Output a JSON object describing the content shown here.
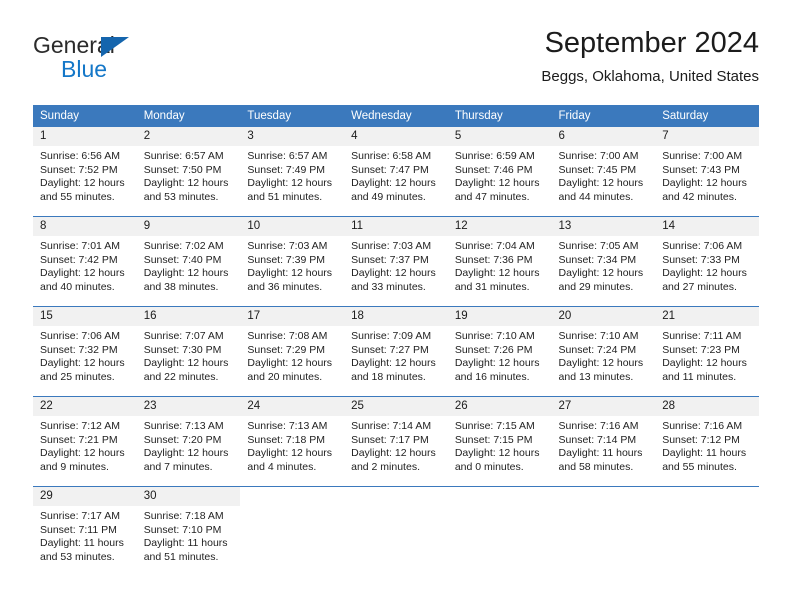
{
  "brand": {
    "name_top": "General",
    "name_bottom": "Blue",
    "accent_color": "#1477c8",
    "triangle_color": "#1565ad"
  },
  "header": {
    "title": "September 2024",
    "subtitle": "Beggs, Oklahoma, United States"
  },
  "theme": {
    "header_blue": "#3b79bd",
    "daynum_band": "#f1f1f1",
    "text": "#1c1c1c"
  },
  "weekday_headers": [
    "Sunday",
    "Monday",
    "Tuesday",
    "Wednesday",
    "Thursday",
    "Friday",
    "Saturday"
  ],
  "weeks": [
    [
      {
        "day": "1",
        "sunrise": "Sunrise: 6:56 AM",
        "sunset": "Sunset: 7:52 PM",
        "daylight_line1": "Daylight: 12 hours",
        "daylight_line2": "and 55 minutes."
      },
      {
        "day": "2",
        "sunrise": "Sunrise: 6:57 AM",
        "sunset": "Sunset: 7:50 PM",
        "daylight_line1": "Daylight: 12 hours",
        "daylight_line2": "and 53 minutes."
      },
      {
        "day": "3",
        "sunrise": "Sunrise: 6:57 AM",
        "sunset": "Sunset: 7:49 PM",
        "daylight_line1": "Daylight: 12 hours",
        "daylight_line2": "and 51 minutes."
      },
      {
        "day": "4",
        "sunrise": "Sunrise: 6:58 AM",
        "sunset": "Sunset: 7:47 PM",
        "daylight_line1": "Daylight: 12 hours",
        "daylight_line2": "and 49 minutes."
      },
      {
        "day": "5",
        "sunrise": "Sunrise: 6:59 AM",
        "sunset": "Sunset: 7:46 PM",
        "daylight_line1": "Daylight: 12 hours",
        "daylight_line2": "and 47 minutes."
      },
      {
        "day": "6",
        "sunrise": "Sunrise: 7:00 AM",
        "sunset": "Sunset: 7:45 PM",
        "daylight_line1": "Daylight: 12 hours",
        "daylight_line2": "and 44 minutes."
      },
      {
        "day": "7",
        "sunrise": "Sunrise: 7:00 AM",
        "sunset": "Sunset: 7:43 PM",
        "daylight_line1": "Daylight: 12 hours",
        "daylight_line2": "and 42 minutes."
      }
    ],
    [
      {
        "day": "8",
        "sunrise": "Sunrise: 7:01 AM",
        "sunset": "Sunset: 7:42 PM",
        "daylight_line1": "Daylight: 12 hours",
        "daylight_line2": "and 40 minutes."
      },
      {
        "day": "9",
        "sunrise": "Sunrise: 7:02 AM",
        "sunset": "Sunset: 7:40 PM",
        "daylight_line1": "Daylight: 12 hours",
        "daylight_line2": "and 38 minutes."
      },
      {
        "day": "10",
        "sunrise": "Sunrise: 7:03 AM",
        "sunset": "Sunset: 7:39 PM",
        "daylight_line1": "Daylight: 12 hours",
        "daylight_line2": "and 36 minutes."
      },
      {
        "day": "11",
        "sunrise": "Sunrise: 7:03 AM",
        "sunset": "Sunset: 7:37 PM",
        "daylight_line1": "Daylight: 12 hours",
        "daylight_line2": "and 33 minutes."
      },
      {
        "day": "12",
        "sunrise": "Sunrise: 7:04 AM",
        "sunset": "Sunset: 7:36 PM",
        "daylight_line1": "Daylight: 12 hours",
        "daylight_line2": "and 31 minutes."
      },
      {
        "day": "13",
        "sunrise": "Sunrise: 7:05 AM",
        "sunset": "Sunset: 7:34 PM",
        "daylight_line1": "Daylight: 12 hours",
        "daylight_line2": "and 29 minutes."
      },
      {
        "day": "14",
        "sunrise": "Sunrise: 7:06 AM",
        "sunset": "Sunset: 7:33 PM",
        "daylight_line1": "Daylight: 12 hours",
        "daylight_line2": "and 27 minutes."
      }
    ],
    [
      {
        "day": "15",
        "sunrise": "Sunrise: 7:06 AM",
        "sunset": "Sunset: 7:32 PM",
        "daylight_line1": "Daylight: 12 hours",
        "daylight_line2": "and 25 minutes."
      },
      {
        "day": "16",
        "sunrise": "Sunrise: 7:07 AM",
        "sunset": "Sunset: 7:30 PM",
        "daylight_line1": "Daylight: 12 hours",
        "daylight_line2": "and 22 minutes."
      },
      {
        "day": "17",
        "sunrise": "Sunrise: 7:08 AM",
        "sunset": "Sunset: 7:29 PM",
        "daylight_line1": "Daylight: 12 hours",
        "daylight_line2": "and 20 minutes."
      },
      {
        "day": "18",
        "sunrise": "Sunrise: 7:09 AM",
        "sunset": "Sunset: 7:27 PM",
        "daylight_line1": "Daylight: 12 hours",
        "daylight_line2": "and 18 minutes."
      },
      {
        "day": "19",
        "sunrise": "Sunrise: 7:10 AM",
        "sunset": "Sunset: 7:26 PM",
        "daylight_line1": "Daylight: 12 hours",
        "daylight_line2": "and 16 minutes."
      },
      {
        "day": "20",
        "sunrise": "Sunrise: 7:10 AM",
        "sunset": "Sunset: 7:24 PM",
        "daylight_line1": "Daylight: 12 hours",
        "daylight_line2": "and 13 minutes."
      },
      {
        "day": "21",
        "sunrise": "Sunrise: 7:11 AM",
        "sunset": "Sunset: 7:23 PM",
        "daylight_line1": "Daylight: 12 hours",
        "daylight_line2": "and 11 minutes."
      }
    ],
    [
      {
        "day": "22",
        "sunrise": "Sunrise: 7:12 AM",
        "sunset": "Sunset: 7:21 PM",
        "daylight_line1": "Daylight: 12 hours",
        "daylight_line2": "and 9 minutes."
      },
      {
        "day": "23",
        "sunrise": "Sunrise: 7:13 AM",
        "sunset": "Sunset: 7:20 PM",
        "daylight_line1": "Daylight: 12 hours",
        "daylight_line2": "and 7 minutes."
      },
      {
        "day": "24",
        "sunrise": "Sunrise: 7:13 AM",
        "sunset": "Sunset: 7:18 PM",
        "daylight_line1": "Daylight: 12 hours",
        "daylight_line2": "and 4 minutes."
      },
      {
        "day": "25",
        "sunrise": "Sunrise: 7:14 AM",
        "sunset": "Sunset: 7:17 PM",
        "daylight_line1": "Daylight: 12 hours",
        "daylight_line2": "and 2 minutes."
      },
      {
        "day": "26",
        "sunrise": "Sunrise: 7:15 AM",
        "sunset": "Sunset: 7:15 PM",
        "daylight_line1": "Daylight: 12 hours",
        "daylight_line2": "and 0 minutes."
      },
      {
        "day": "27",
        "sunrise": "Sunrise: 7:16 AM",
        "sunset": "Sunset: 7:14 PM",
        "daylight_line1": "Daylight: 11 hours",
        "daylight_line2": "and 58 minutes."
      },
      {
        "day": "28",
        "sunrise": "Sunrise: 7:16 AM",
        "sunset": "Sunset: 7:12 PM",
        "daylight_line1": "Daylight: 11 hours",
        "daylight_line2": "and 55 minutes."
      }
    ],
    [
      {
        "day": "29",
        "sunrise": "Sunrise: 7:17 AM",
        "sunset": "Sunset: 7:11 PM",
        "daylight_line1": "Daylight: 11 hours",
        "daylight_line2": "and 53 minutes."
      },
      {
        "day": "30",
        "sunrise": "Sunrise: 7:18 AM",
        "sunset": "Sunset: 7:10 PM",
        "daylight_line1": "Daylight: 11 hours",
        "daylight_line2": "and 51 minutes."
      },
      {
        "day": "",
        "sunrise": "",
        "sunset": "",
        "daylight_line1": "",
        "daylight_line2": ""
      },
      {
        "day": "",
        "sunrise": "",
        "sunset": "",
        "daylight_line1": "",
        "daylight_line2": ""
      },
      {
        "day": "",
        "sunrise": "",
        "sunset": "",
        "daylight_line1": "",
        "daylight_line2": ""
      },
      {
        "day": "",
        "sunrise": "",
        "sunset": "",
        "daylight_line1": "",
        "daylight_line2": ""
      },
      {
        "day": "",
        "sunrise": "",
        "sunset": "",
        "daylight_line1": "",
        "daylight_line2": ""
      }
    ]
  ]
}
